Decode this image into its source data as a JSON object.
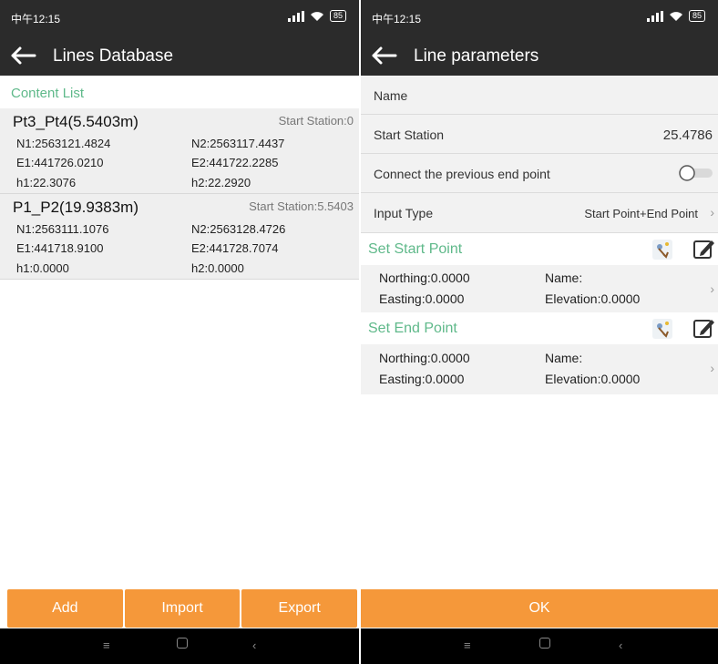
{
  "status": {
    "left_time": "中午12:15",
    "right_time": "中午12:15",
    "battery": "85"
  },
  "left": {
    "title": "Lines Database",
    "content_label": "Content List",
    "lines": [
      {
        "name": "Pt3_Pt4(5.5403m)",
        "station": "Start Station:0",
        "n1": "N1:2563121.4824",
        "n2": "N2:2563117.4437",
        "e1": "E1:441726.0210",
        "e2": "E2:441722.2285",
        "h1": "h1:22.3076",
        "h2": "h2:22.2920"
      },
      {
        "name": "P1_P2(19.9383m)",
        "station": "Start Station:5.5403",
        "n1": "N1:2563111.1076",
        "n2": "N2:2563128.4726",
        "e1": "E1:441718.9100",
        "e2": "E2:441728.7074",
        "h1": "h1:0.0000",
        "h2": "h2:0.0000"
      }
    ],
    "buttons": {
      "add": "Add",
      "import": "Import",
      "export": "Export"
    }
  },
  "right": {
    "title": "Line parameters",
    "name_label": "Name",
    "start_station_label": "Start Station",
    "start_station_value": "25.4786",
    "connect_label": "Connect the previous end point",
    "input_type_label": "Input Type",
    "input_type_value": "Start Point+End Point",
    "start_section": "Set Start Point",
    "start_point": {
      "northing": "Northing:0.0000",
      "easting": "Easting:0.0000",
      "name": "Name:",
      "elevation": "Elevation:0.0000"
    },
    "end_section": "Set End Point",
    "end_point": {
      "northing": "Northing:0.0000",
      "easting": "Easting:0.0000",
      "name": "Name:",
      "elevation": "Elevation:0.0000"
    },
    "ok": "OK"
  },
  "icons": {
    "back": "arrow-left-icon",
    "pick": "map-pick-icon",
    "edit": "pencil-icon",
    "chevron": "chevron-right-icon",
    "toggle": "toggle-off-icon"
  },
  "colors": {
    "accent_green": "#5fb98a",
    "button_orange": "#f5983a",
    "appbar": "#2b2b2b"
  }
}
